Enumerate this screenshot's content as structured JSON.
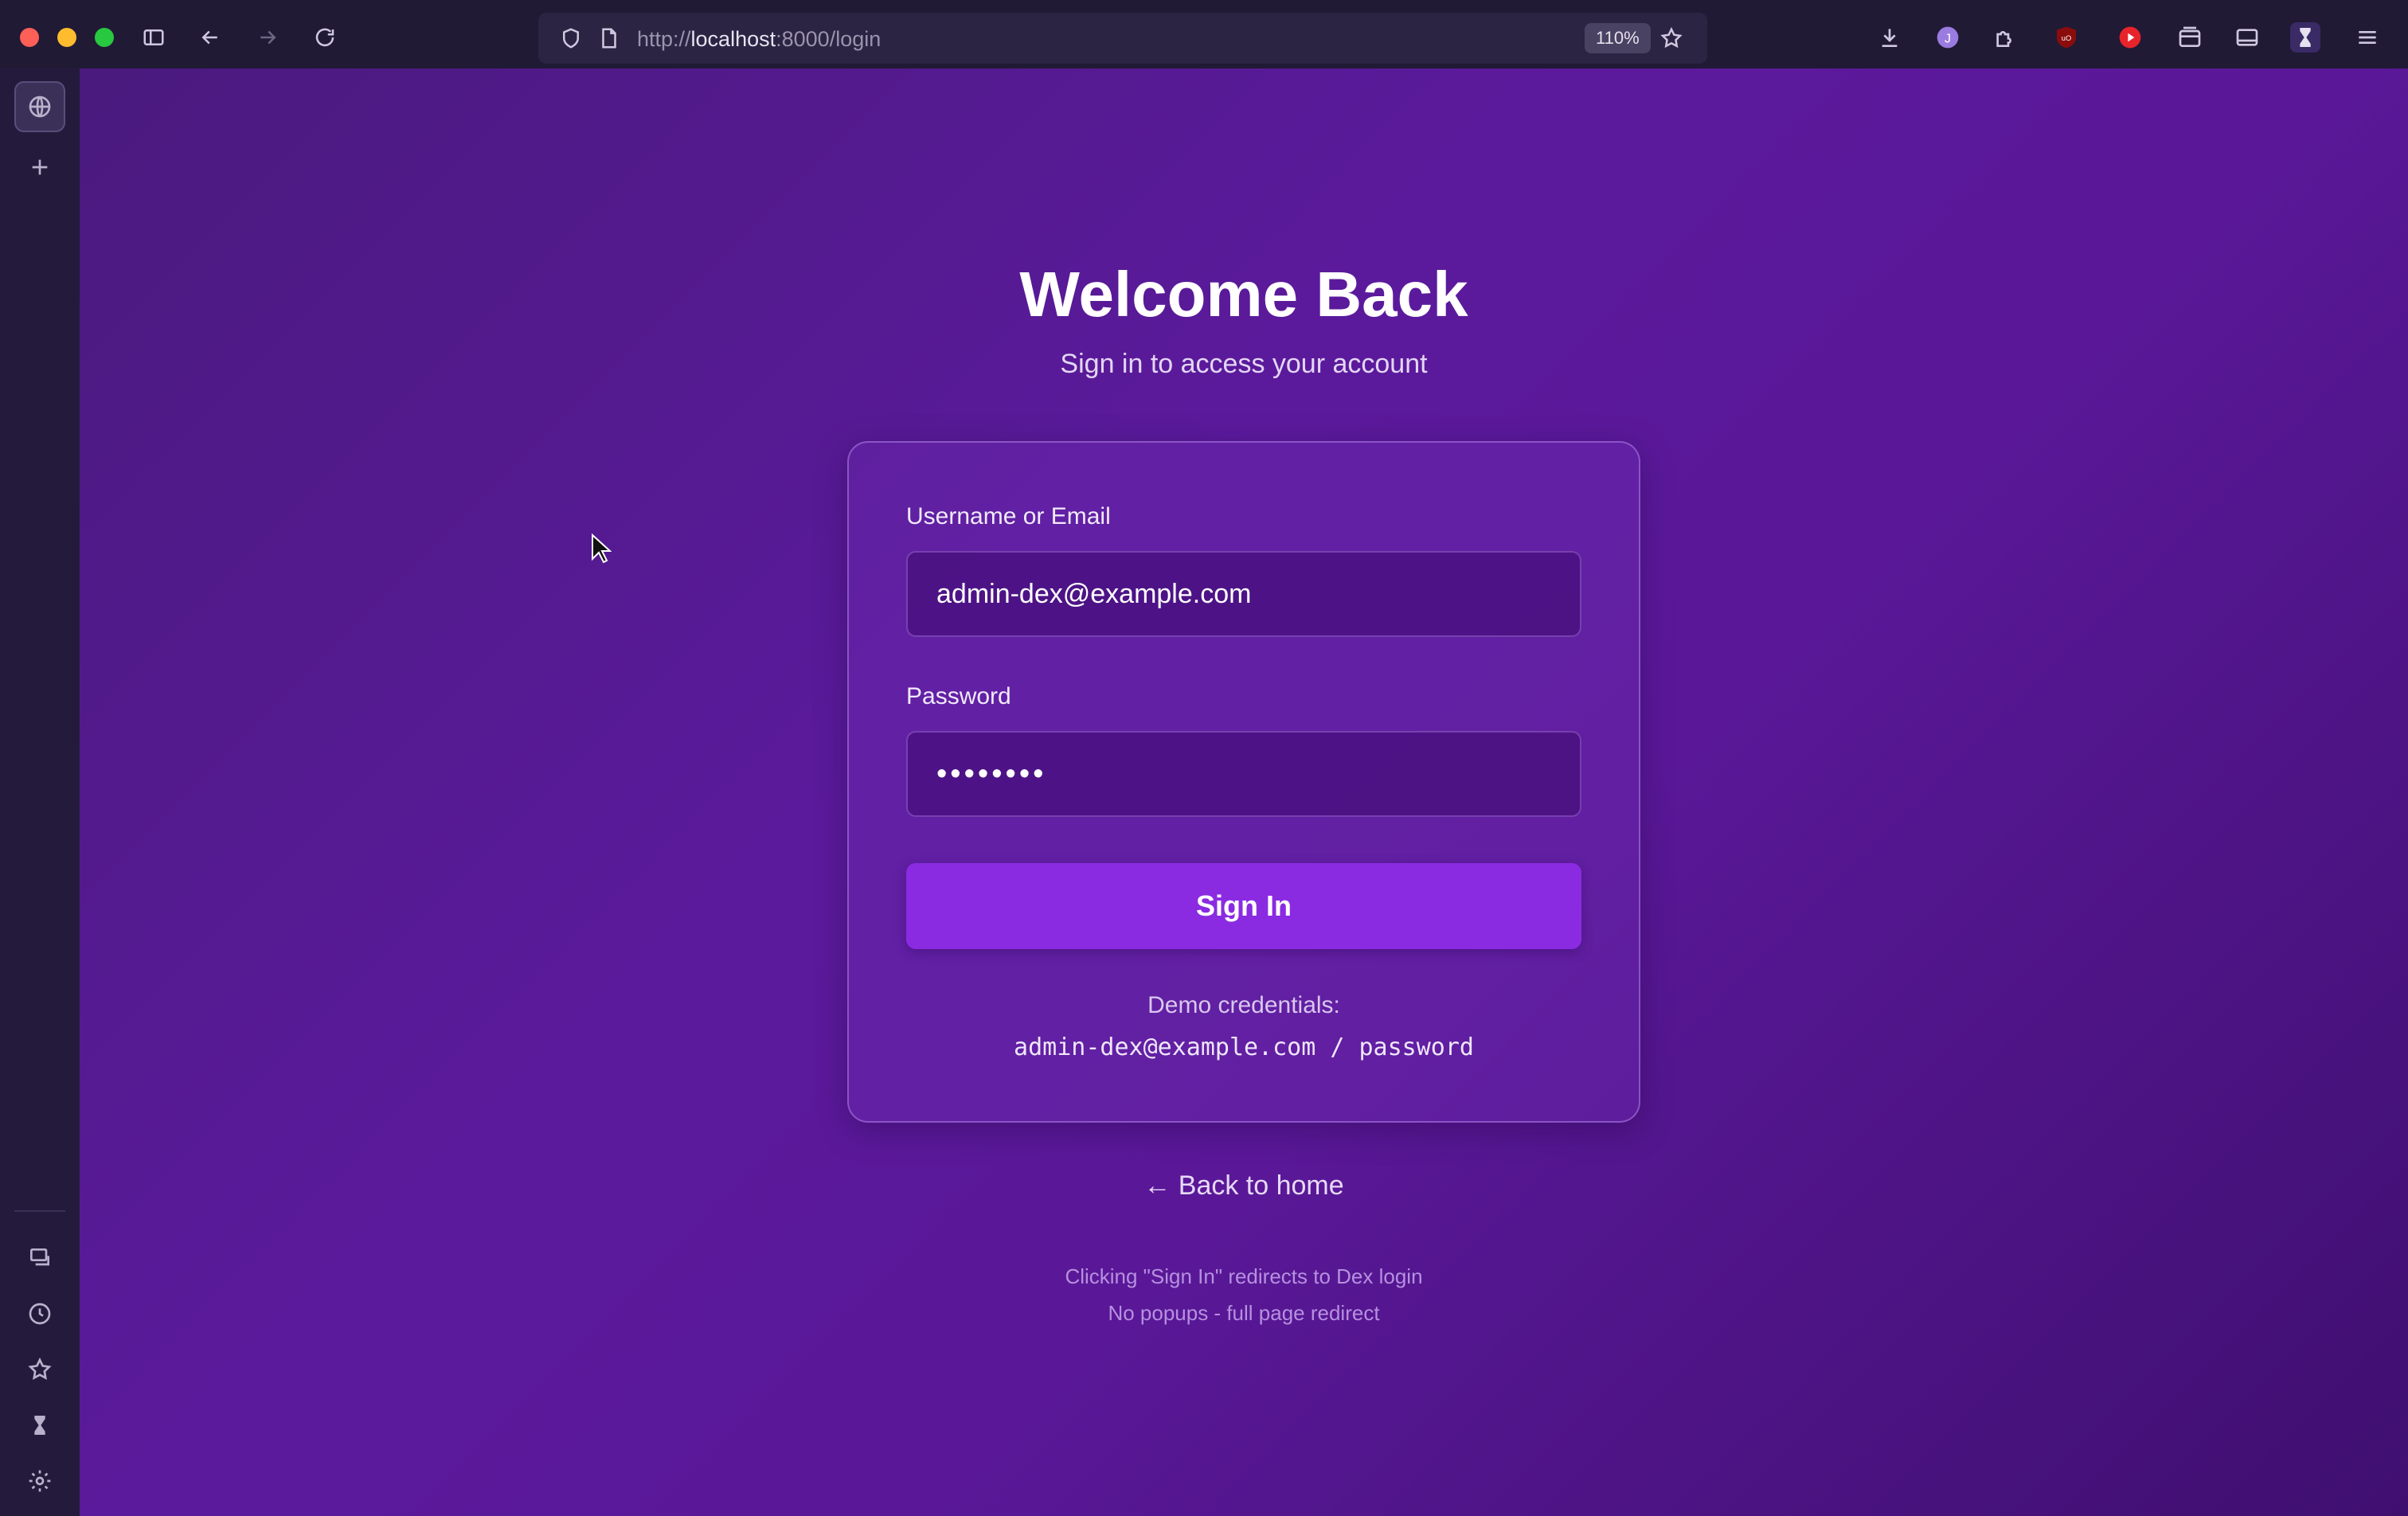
{
  "browser": {
    "url_scheme": "http://",
    "url_host": "localhost",
    "url_path": ":8000/login",
    "zoom": "110%"
  },
  "page": {
    "title": "Welcome Back",
    "subtitle": "Sign in to access your account",
    "form": {
      "username_label": "Username or Email",
      "username_value": "admin-dex@example.com",
      "password_label": "Password",
      "password_value": "••••••••",
      "submit_label": "Sign In",
      "demo_label": "Demo credentials:",
      "demo_credentials": "admin-dex@example.com / password"
    },
    "back_link": "← Back to home",
    "footnote_1": "Clicking \"Sign In\" redirects to Dex login",
    "footnote_2": "No popups - full page redirect"
  },
  "colors": {
    "accent": "#8a2be2",
    "background": "#5b1a9c"
  }
}
